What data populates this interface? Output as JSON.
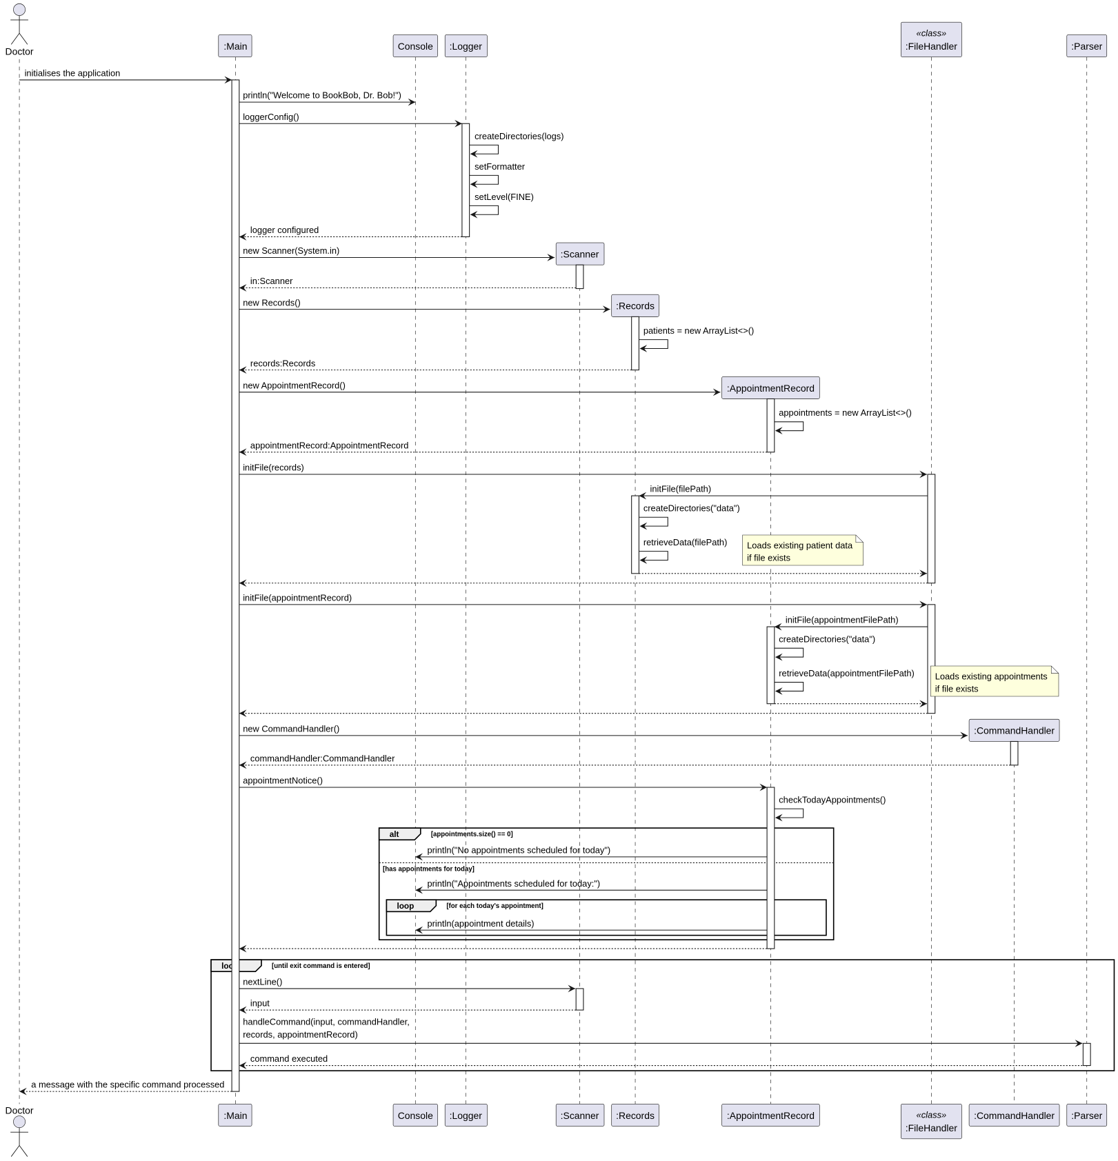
{
  "actor": {
    "name": "Doctor"
  },
  "participants": [
    {
      "id": "main",
      "name": ":Main"
    },
    {
      "id": "console",
      "name": "Console"
    },
    {
      "id": "logger",
      "name": ":Logger"
    },
    {
      "id": "scanner",
      "name": ":Scanner"
    },
    {
      "id": "records",
      "name": ":Records"
    },
    {
      "id": "appointmentrecord",
      "name": ":AppointmentRecord"
    },
    {
      "id": "filehandler",
      "name": ":FileHandler",
      "stereotype": "«class»"
    },
    {
      "id": "commandhandler",
      "name": ":CommandHandler"
    },
    {
      "id": "parser",
      "name": ":Parser"
    }
  ],
  "messages": [
    {
      "label": "initialises the application"
    },
    {
      "label": "println(\"Welcome to BookBob, Dr. Bob!\")"
    },
    {
      "label": "loggerConfig()"
    },
    {
      "label": "createDirectories(logs)"
    },
    {
      "label": "setFormatter"
    },
    {
      "label": "setLevel(FINE)"
    },
    {
      "label": "logger configured"
    },
    {
      "label": "new Scanner(System.in)"
    },
    {
      "label": "in:Scanner"
    },
    {
      "label": "new Records()"
    },
    {
      "label": "patients = new ArrayList<>()"
    },
    {
      "label": "records:Records"
    },
    {
      "label": "new AppointmentRecord()"
    },
    {
      "label": "appointments = new ArrayList<>()"
    },
    {
      "label": "appointmentRecord:AppointmentRecord"
    },
    {
      "label": "initFile(records)"
    },
    {
      "label": "initFile(filePath)"
    },
    {
      "label": "createDirectories(\"data\")"
    },
    {
      "label": "retrieveData(filePath)"
    },
    {
      "label": ""
    },
    {
      "label": ""
    },
    {
      "label": "initFile(appointmentRecord)"
    },
    {
      "label": "initFile(appointmentFilePath)"
    },
    {
      "label": "createDirectories(\"data\")"
    },
    {
      "label": "retrieveData(appointmentFilePath)"
    },
    {
      "label": ""
    },
    {
      "label": ""
    },
    {
      "label": "new CommandHandler()"
    },
    {
      "label": "commandHandler:CommandHandler"
    },
    {
      "label": "appointmentNotice()"
    },
    {
      "label": "checkTodayAppointments()"
    },
    {
      "label": "println(\"No appointments scheduled for today\")"
    },
    {
      "label": "println(\"Appointments scheduled for today:\")"
    },
    {
      "label": "println(appointment details)"
    },
    {
      "label": ""
    },
    {
      "label": "nextLine()"
    },
    {
      "label": "input"
    },
    {
      "label": "handleCommand(input, commandHandler,",
      "label2": "records, appointmentRecord)"
    },
    {
      "label": "command executed"
    },
    {
      "label": "a message with the specific command processed"
    }
  ],
  "notes": [
    {
      "line1": "Loads existing patient data",
      "line2": "if file exists"
    },
    {
      "line1": "Loads existing appointments",
      "line2": "if file exists"
    }
  ],
  "frames": [
    {
      "kind": "alt",
      "guard": "[appointments.size() == 0]",
      "else_guard": "[has appointments for today]"
    },
    {
      "kind": "loop",
      "guard": "[for each today's appointment]"
    },
    {
      "kind": "loop",
      "guard": "[until exit command is entered]"
    }
  ],
  "colors": {
    "participant_fill": "#E2E2F0",
    "note_fill": "#FEFFDD",
    "frame_tab": "#EEEEEE"
  }
}
